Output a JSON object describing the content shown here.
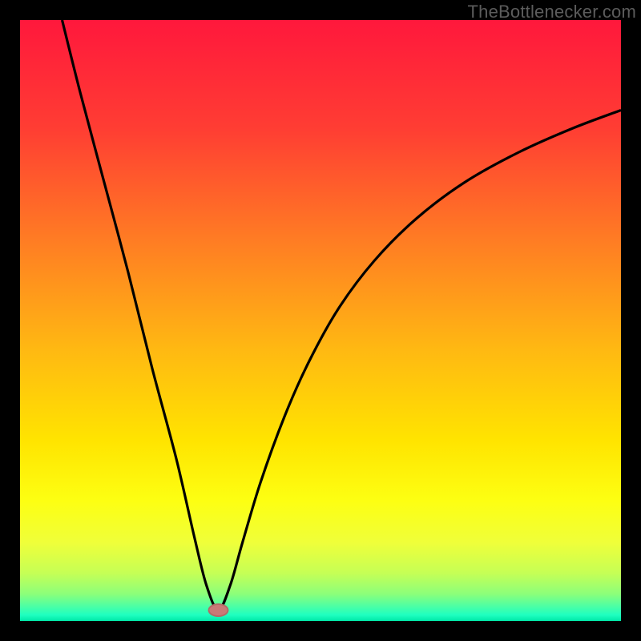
{
  "watermark": "TheBottleneсker.com",
  "colors": {
    "frame": "#000000",
    "curve": "#000000",
    "marker_fill": "#c97a77",
    "marker_stroke": "#b36a66",
    "watermark": "#5c5c5c",
    "gradient_stops": [
      {
        "offset": 0.0,
        "color": "#ff183c"
      },
      {
        "offset": 0.18,
        "color": "#ff3d33"
      },
      {
        "offset": 0.36,
        "color": "#ff7a24"
      },
      {
        "offset": 0.55,
        "color": "#ffb912"
      },
      {
        "offset": 0.7,
        "color": "#ffe400"
      },
      {
        "offset": 0.8,
        "color": "#fdff12"
      },
      {
        "offset": 0.87,
        "color": "#efff3a"
      },
      {
        "offset": 0.92,
        "color": "#c6ff55"
      },
      {
        "offset": 0.955,
        "color": "#8cff7a"
      },
      {
        "offset": 0.975,
        "color": "#4effa4"
      },
      {
        "offset": 0.99,
        "color": "#1fffc0"
      },
      {
        "offset": 1.0,
        "color": "#00e8a8"
      }
    ]
  },
  "chart_data": {
    "type": "line",
    "title": "",
    "xlabel": "",
    "ylabel": "",
    "x_range": [
      0,
      100
    ],
    "y_range": [
      0,
      100
    ],
    "optimum_x": 33,
    "curve": [
      {
        "x": 7,
        "y": 100
      },
      {
        "x": 10,
        "y": 88
      },
      {
        "x": 14,
        "y": 73
      },
      {
        "x": 18,
        "y": 58
      },
      {
        "x": 22,
        "y": 42
      },
      {
        "x": 26,
        "y": 27
      },
      {
        "x": 29,
        "y": 14
      },
      {
        "x": 31,
        "y": 6
      },
      {
        "x": 33,
        "y": 1.8
      },
      {
        "x": 35,
        "y": 6
      },
      {
        "x": 37,
        "y": 13
      },
      {
        "x": 40,
        "y": 23
      },
      {
        "x": 44,
        "y": 34
      },
      {
        "x": 48,
        "y": 43
      },
      {
        "x": 53,
        "y": 52
      },
      {
        "x": 59,
        "y": 60
      },
      {
        "x": 66,
        "y": 67
      },
      {
        "x": 74,
        "y": 73
      },
      {
        "x": 83,
        "y": 78
      },
      {
        "x": 92,
        "y": 82
      },
      {
        "x": 100,
        "y": 85
      }
    ],
    "marker": {
      "x": 33,
      "y": 1.8,
      "rx": 1.6,
      "ry": 1.0
    }
  }
}
